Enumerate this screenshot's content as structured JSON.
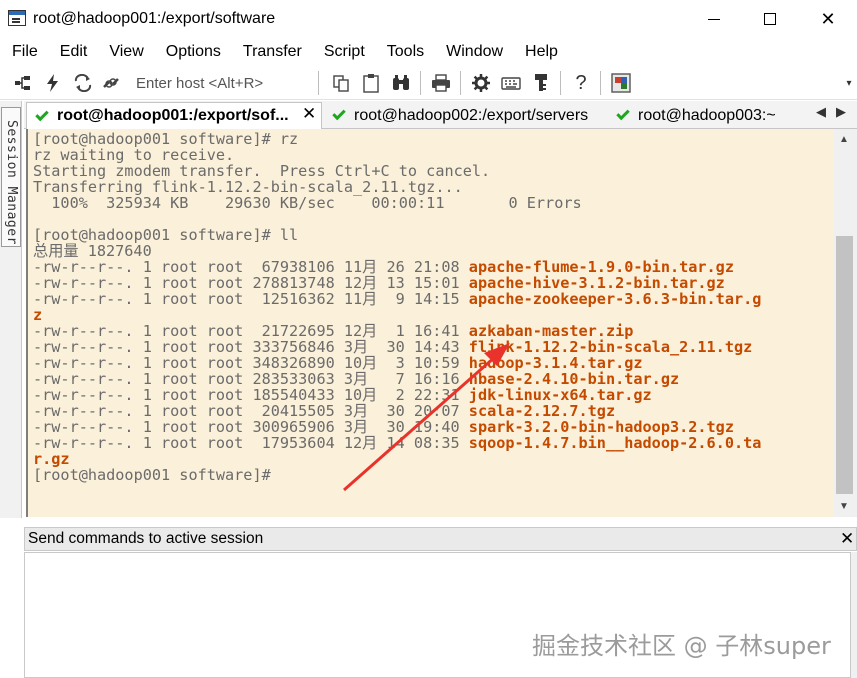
{
  "window": {
    "title": "root@hadoop001:/export/software"
  },
  "menu": [
    "File",
    "Edit",
    "View",
    "Options",
    "Transfer",
    "Script",
    "Tools",
    "Window",
    "Help"
  ],
  "toolbar": {
    "host_placeholder": "Enter host <Alt+R>",
    "icons": [
      "connect-icon",
      "quick-connect-icon",
      "reconnect-icon",
      "disconnect-icon",
      "copy-icon",
      "paste-icon",
      "find-icon",
      "print-icon",
      "settings-icon",
      "keymap-icon",
      "key-icon",
      "help-icon",
      "sftp-icon"
    ]
  },
  "session_manager": {
    "label": "Session Manager"
  },
  "tabs": [
    {
      "label": "root@hadoop001:/export/sof...",
      "active": true
    },
    {
      "label": "root@hadoop002:/export/servers",
      "active": false
    },
    {
      "label": "root@hadoop003:~",
      "active": false
    }
  ],
  "terminal": {
    "lines": [
      {
        "text": "[root@hadoop001 software]# rz",
        "file": ""
      },
      {
        "text": "rz waiting to receive.",
        "file": ""
      },
      {
        "text": "Starting zmodem transfer.  Press Ctrl+C to cancel.",
        "file": ""
      },
      {
        "text": "Transferring flink-1.12.2-bin-scala_2.11.tgz...",
        "file": ""
      },
      {
        "text": "  100%  325934 KB    29630 KB/sec    00:00:11       0 Errors",
        "file": ""
      },
      {
        "text": "",
        "file": ""
      },
      {
        "text": "[root@hadoop001 software]# ll",
        "file": ""
      },
      {
        "text": "总用量 1827640",
        "file": ""
      },
      {
        "text": "-rw-r--r--. 1 root root  67938106 11月 26 21:08 ",
        "file": "apache-flume-1.9.0-bin.tar.gz"
      },
      {
        "text": "-rw-r--r--. 1 root root 278813748 12月 13 15:01 ",
        "file": "apache-hive-3.1.2-bin.tar.gz"
      },
      {
        "text": "-rw-r--r--. 1 root root  12516362 11月  9 14:15 ",
        "file": "apache-zookeeper-3.6.3-bin.tar.g"
      },
      {
        "text": "",
        "file": "z"
      },
      {
        "text": "-rw-r--r--. 1 root root  21722695 12月  1 16:41 ",
        "file": "azkaban-master.zip"
      },
      {
        "text": "-rw-r--r--. 1 root root 333756846 3月  30 14:43 ",
        "file": "flink-1.12.2-bin-scala_2.11.tgz"
      },
      {
        "text": "-rw-r--r--. 1 root root 348326890 10月  3 10:59 ",
        "file": "hadoop-3.1.4.tar.gz"
      },
      {
        "text": "-rw-r--r--. 1 root root 283533063 3月   7 16:16 ",
        "file": "hbase-2.4.10-bin.tar.gz"
      },
      {
        "text": "-rw-r--r--. 1 root root 185540433 10月  2 22:31 ",
        "file": "jdk-linux-x64.tar.gz"
      },
      {
        "text": "-rw-r--r--. 1 root root  20415505 3月  30 20:07 ",
        "file": "scala-2.12.7.tgz"
      },
      {
        "text": "-rw-r--r--. 1 root root 300965906 3月  30 19:40 ",
        "file": "spark-3.2.0-bin-hadoop3.2.tgz"
      },
      {
        "text": "-rw-r--r--. 1 root root  17953604 12月 14 08:35 ",
        "file": "sqoop-1.4.7.bin__hadoop-2.6.0.ta"
      },
      {
        "text": "",
        "file": "r.gz"
      },
      {
        "text": "[root@hadoop001 software]# ",
        "file": ""
      }
    ]
  },
  "send_panel": {
    "title": "Send commands to active session",
    "value": ""
  },
  "watermark": "掘金技术社区 @ 子林super",
  "colors": {
    "terminal_bg": "#fbf0d9",
    "terminal_text": "#6b6b6b",
    "filename": "#c44a00",
    "arrow": "#e8322b",
    "check": "#1fa61f"
  }
}
